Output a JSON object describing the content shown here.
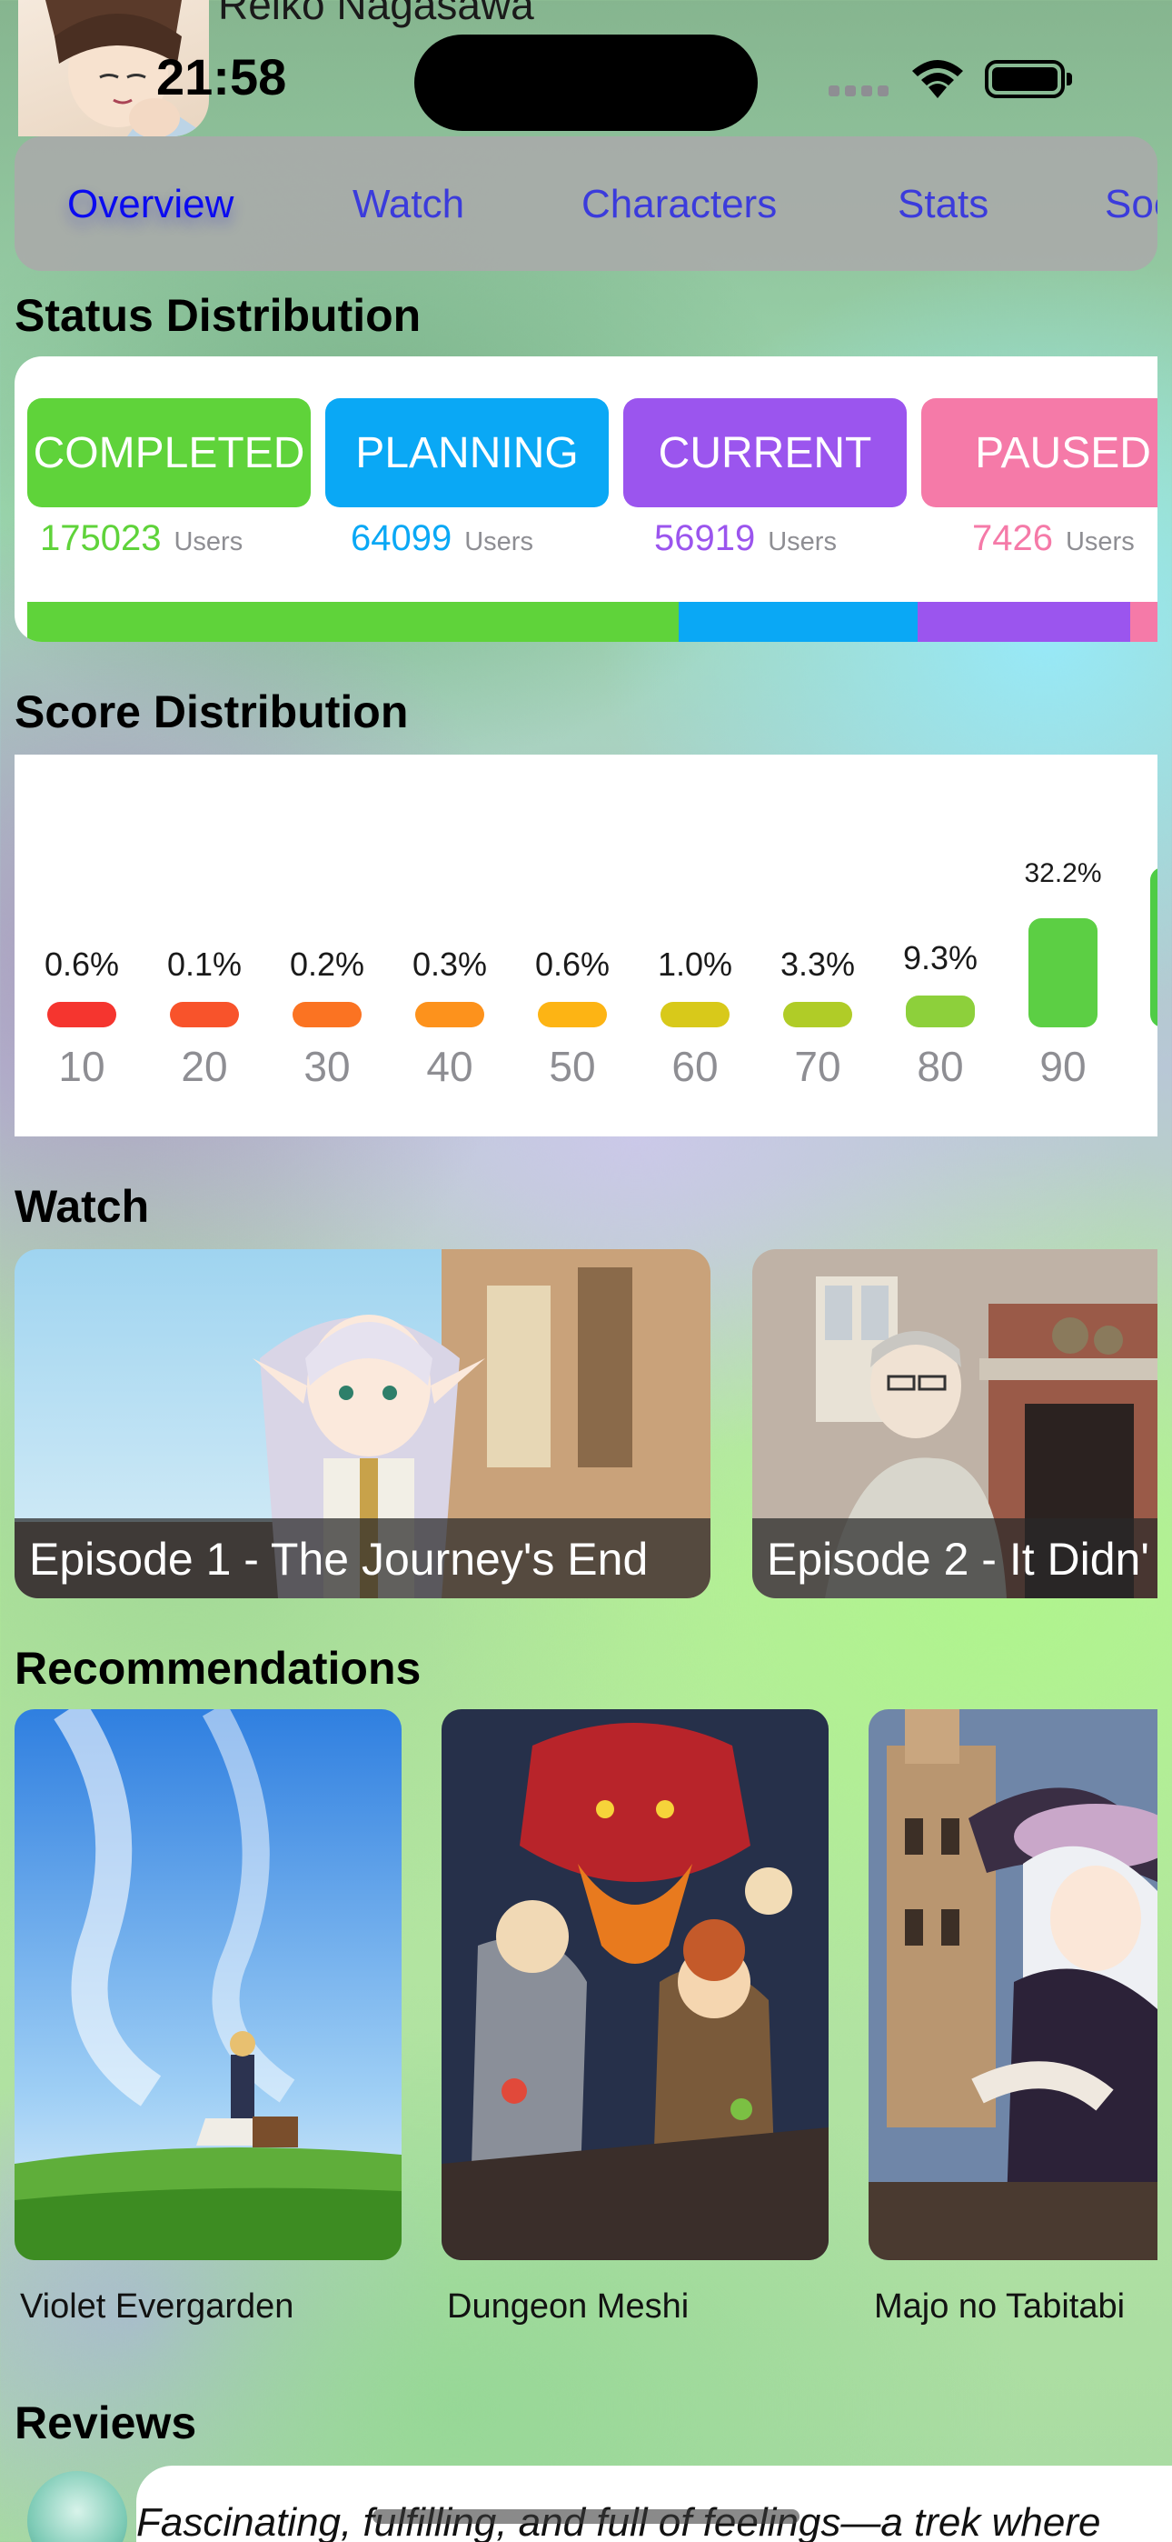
{
  "profile": {
    "name": "Reiko Nagasawa"
  },
  "status_bar": {
    "time": "21:58"
  },
  "tabs": [
    {
      "label": "Overview",
      "active": true
    },
    {
      "label": "Watch",
      "active": false
    },
    {
      "label": "Characters",
      "active": false
    },
    {
      "label": "Stats",
      "active": false
    },
    {
      "label": "Soc",
      "active": false
    }
  ],
  "status_distribution": {
    "title": "Status Distribution",
    "unit_label": "Users",
    "items": [
      {
        "label": "COMPLETED",
        "count": "175023",
        "color": "#5fd33a"
      },
      {
        "label": "PLANNING",
        "count": "64099",
        "color": "#0aa8f5"
      },
      {
        "label": "CURRENT",
        "count": "56919",
        "color": "#9b55ee"
      },
      {
        "label": "PAUSED",
        "count": "7426",
        "color": "#f57aa8"
      }
    ]
  },
  "score_distribution": {
    "title": "Score Distribution",
    "scores": [
      "10",
      "20",
      "30",
      "40",
      "50",
      "60",
      "70",
      "80",
      "90"
    ],
    "percents": [
      "0.6%",
      "0.1%",
      "0.2%",
      "0.3%",
      "0.6%",
      "1.0%",
      "3.3%",
      "9.3%",
      "32.2%"
    ],
    "values": [
      0.6,
      0.1,
      0.2,
      0.3,
      0.6,
      1.0,
      3.3,
      9.3,
      32.2
    ],
    "colors": [
      "#f5352f",
      "#f8532b",
      "#fb7322",
      "#fd921c",
      "#fdb414",
      "#d8c91a",
      "#b0cc27",
      "#8dd03b",
      "#5ccf44"
    ]
  },
  "watch": {
    "title": "Watch",
    "episodes": [
      {
        "caption": "Episode 1 - The Journey's End"
      },
      {
        "caption": "Episode 2 - It Didn'"
      }
    ]
  },
  "recommendations": {
    "title": "Recommendations",
    "items": [
      {
        "title": "Violet Evergarden"
      },
      {
        "title": "Dungeon Meshi"
      },
      {
        "title": "Majo no Tabitabi"
      }
    ]
  },
  "reviews": {
    "title": "Reviews",
    "first_excerpt": "Fascinating, fulfilling, and full of feelings—a trek where"
  }
}
